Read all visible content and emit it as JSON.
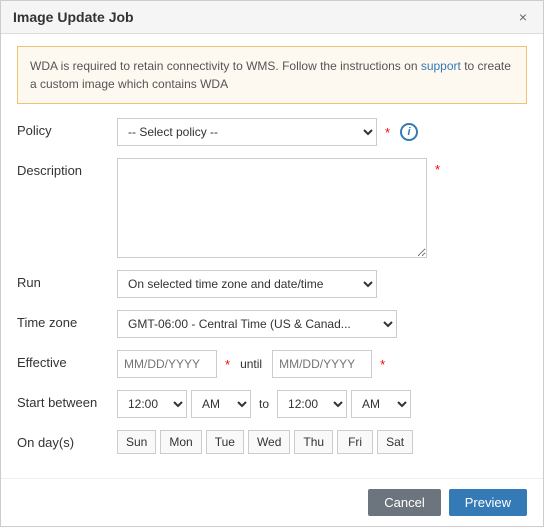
{
  "dialog": {
    "title": "Image Update Job",
    "close_label": "×"
  },
  "alert": {
    "message_before": "WDA is required to retain connectivity to WMS. Follow the instructions on ",
    "link_text": "support",
    "message_after": " to create a custom image which contains WDA"
  },
  "form": {
    "policy_label": "Policy",
    "policy_placeholder": "-- Select policy --",
    "description_label": "Description",
    "run_label": "Run",
    "run_default": "On selected time zone and date/time",
    "timezone_label": "Time zone",
    "timezone_default": "GMT-06:00 - Central Time (US & Canad...",
    "effective_label": "Effective",
    "effective_placeholder": "MM/DD/YYYY",
    "until_label": "until",
    "until_placeholder": "MM/DD/YYYY",
    "start_between_label": "Start between",
    "time1_default": "12:00",
    "ampm1_default": "AM",
    "to_label": "to",
    "time2_default": "12:00",
    "ampm2_default": "AM",
    "on_days_label": "On day(s)",
    "days": [
      "Sun",
      "Mon",
      "Tue",
      "Wed",
      "Thu",
      "Fri",
      "Sat"
    ]
  },
  "footer": {
    "cancel_label": "Cancel",
    "preview_label": "Preview"
  }
}
